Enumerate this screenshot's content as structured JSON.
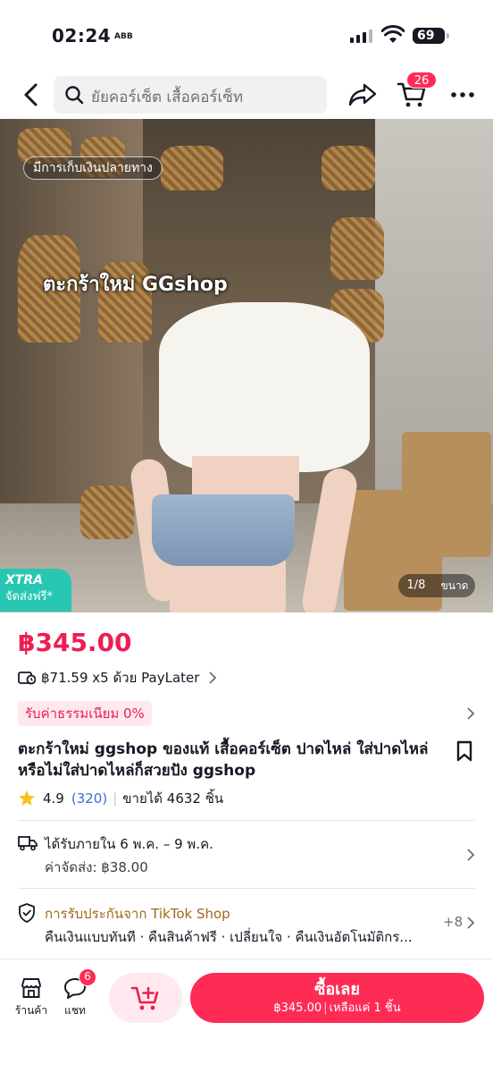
{
  "status_bar": {
    "time": "02:24",
    "extra": "ABB",
    "battery": "69"
  },
  "nav": {
    "search_text": "ยัยคอร์เซ็ต เสื้อคอร์เซ็ท",
    "cart_count": "26"
  },
  "hero": {
    "cod_label": "มีการเก็บเงินปลายทาง",
    "watermark": "ตะกร้าใหม่ GGshop",
    "xtra_title": "XTRA",
    "xtra_sub": "จัดส่งฟรี*",
    "page_counter": "1/8",
    "size_label": "ขนาด"
  },
  "product": {
    "price": "฿345.00",
    "paylater": "฿71.59 x5 ด้วย PayLater",
    "fee_tag": "รับค่าธรรมเนียม 0%",
    "title": "ตะกร้าใหม่ ggshop ของแท้ เสื้อคอร์เซ็ต ปาดไหล่ ใส่ปาดไหล่หรือไม่ใส่ปาดไหล่ก็สวยปัง ggshop",
    "rating": "4.9",
    "rating_count": "(320)",
    "rating_sep": "|",
    "sold": "ขายได้ 4632 ชิ้น"
  },
  "shipping": {
    "date": "ได้รับภายใน 6 พ.ค. – 9 พ.ค.",
    "fee": "ค่าจัดส่ง: ฿38.00"
  },
  "guarantee": {
    "title": "การรับประกันจาก TikTok Shop",
    "items": "คืนเงินแบบทันที · คืนสินค้าฟรี · เปลี่ยนใจ · คืนเงินอัตโนมัติกร...",
    "more": "+8"
  },
  "bottom_bar": {
    "store_label": "ร้านค้า",
    "chat_label": "แชท",
    "chat_badge": "6",
    "buy_label": "ซื้อเลย",
    "buy_price": "฿345.00",
    "buy_sep": "|",
    "buy_stock": "เหลือแค่ 1 ชิ้น"
  },
  "colors": {
    "accent": "#fe2c55",
    "price": "#ee1d52",
    "xtra": "#27c7b3",
    "guarantee": "#a0681a",
    "link": "#3b6fd3"
  }
}
